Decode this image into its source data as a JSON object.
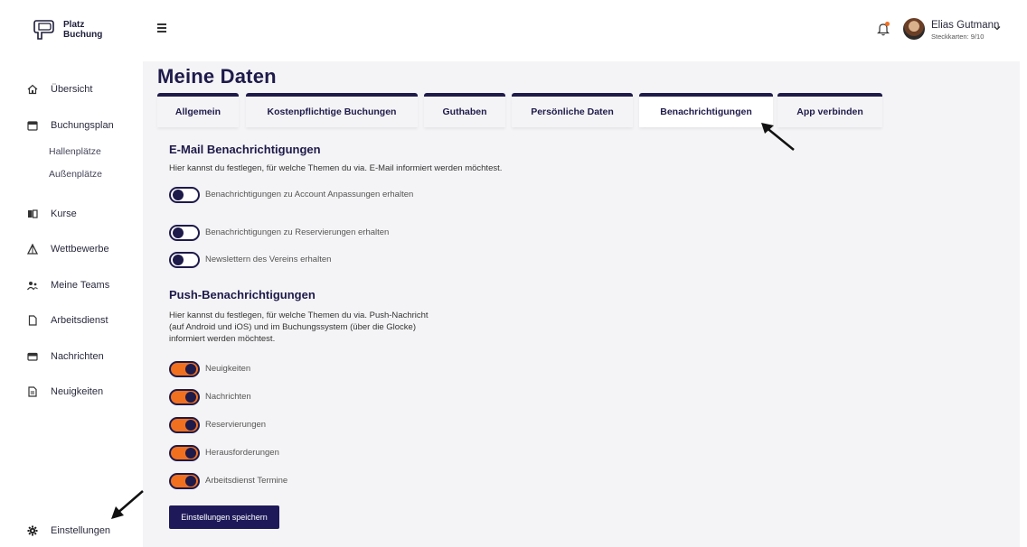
{
  "brand": {
    "line1": "Platz",
    "line2": "Buchung"
  },
  "sidebar": {
    "items": [
      {
        "label": "Übersicht",
        "icon": "home-icon"
      },
      {
        "label": "Buchungsplan",
        "icon": "calendar-icon"
      },
      {
        "label": "Kurse",
        "icon": "book-icon"
      },
      {
        "label": "Wettbewerbe",
        "icon": "trophy-icon"
      },
      {
        "label": "Meine Teams",
        "icon": "team-icon"
      },
      {
        "label": "Arbeitsdienst",
        "icon": "document-icon"
      },
      {
        "label": "Nachrichten",
        "icon": "mail-icon"
      },
      {
        "label": "Neuigkeiten",
        "icon": "news-icon"
      }
    ],
    "subitems": [
      "Hallenplätze",
      "Außenplätze"
    ],
    "settings": "Einstellungen"
  },
  "user": {
    "name": "Elias Gutmann",
    "subtitle": "Steckkarten: 9/10"
  },
  "page": {
    "title": "Meine Daten"
  },
  "tabs": [
    "Allgemein",
    "Kostenpflichtige Buchungen",
    "Guthaben",
    "Persönliche Daten",
    "Benachrichtigungen",
    "App verbinden"
  ],
  "active_tab": "Benachrichtigungen",
  "email": {
    "title": "E-Mail Benachrichtigungen",
    "description": "Hier kannst du festlegen, für welche Themen du via. E-Mail informiert werden möchtest.",
    "toggles": [
      {
        "label": "Benachrichtigungen zu Account Anpassungen erhalten",
        "on": false
      },
      {
        "label": "Benachrichtigungen zu Reservierungen erhalten",
        "on": false
      },
      {
        "label": "Newslettern des Vereins erhalten",
        "on": false
      }
    ]
  },
  "push": {
    "title": "Push-Benachrichtigungen",
    "description": "Hier kannst du festlegen, für welche Themen du via. Push-Nachricht (auf Android und iOS) und im Buchungssystem (über die Glocke) informiert werden möchtest.",
    "toggles": [
      {
        "label": "Neuigkeiten",
        "on": true
      },
      {
        "label": "Nachrichten",
        "on": true
      },
      {
        "label": "Reservierungen",
        "on": true
      },
      {
        "label": "Herausforderungen",
        "on": true
      },
      {
        "label": "Arbeitsdienst Termine",
        "on": true
      }
    ]
  },
  "save_label": "Einstellungen speichern",
  "colors": {
    "navy": "#1e1a4a",
    "orange": "#f07020",
    "background": "#f4f4f6"
  }
}
